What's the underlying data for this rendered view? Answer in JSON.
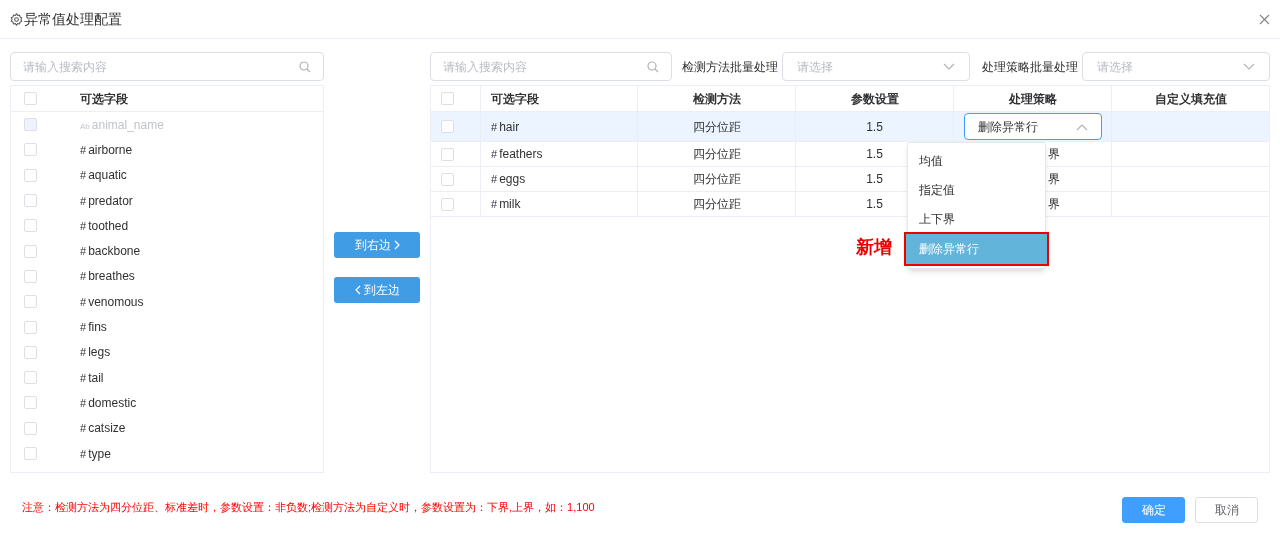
{
  "dialog": {
    "title": "异常值处理配置"
  },
  "left_panel": {
    "search": {
      "placeholder": "请输入搜索内容"
    },
    "header": {
      "label": "可选字段",
      "checked": false
    },
    "items": [
      {
        "type_mark": "Ab",
        "kind": "text",
        "label": "animal_name",
        "checked": false,
        "disabled": true
      },
      {
        "type_mark": "#",
        "kind": "number",
        "label": "airborne",
        "checked": false,
        "disabled": false
      },
      {
        "type_mark": "#",
        "kind": "number",
        "label": "aquatic",
        "checked": false,
        "disabled": false
      },
      {
        "type_mark": "#",
        "kind": "number",
        "label": "predator",
        "checked": false,
        "disabled": false
      },
      {
        "type_mark": "#",
        "kind": "number",
        "label": "toothed",
        "checked": false,
        "disabled": false
      },
      {
        "type_mark": "#",
        "kind": "number",
        "label": "backbone",
        "checked": false,
        "disabled": false
      },
      {
        "type_mark": "#",
        "kind": "number",
        "label": "breathes",
        "checked": false,
        "disabled": false
      },
      {
        "type_mark": "#",
        "kind": "number",
        "label": "venomous",
        "checked": false,
        "disabled": false
      },
      {
        "type_mark": "#",
        "kind": "number",
        "label": "fins",
        "checked": false,
        "disabled": false
      },
      {
        "type_mark": "#",
        "kind": "number",
        "label": "legs",
        "checked": false,
        "disabled": false
      },
      {
        "type_mark": "#",
        "kind": "number",
        "label": "tail",
        "checked": false,
        "disabled": false
      },
      {
        "type_mark": "#",
        "kind": "number",
        "label": "domestic",
        "checked": false,
        "disabled": false
      },
      {
        "type_mark": "#",
        "kind": "number",
        "label": "catsize",
        "checked": false,
        "disabled": false
      },
      {
        "type_mark": "#",
        "kind": "number",
        "label": "type",
        "checked": false,
        "disabled": false
      }
    ]
  },
  "transfer_buttons": [
    {
      "label": "到右边",
      "kind": "right"
    },
    {
      "label": "到左边",
      "kind": "left"
    }
  ],
  "right_panel": {
    "search": {
      "placeholder": "请输入搜索内容"
    },
    "batch_selects": [
      {
        "label": "检测方法批量处理",
        "placeholder": "请选择"
      },
      {
        "label": "处理策略批量处理",
        "placeholder": "请选择"
      }
    ],
    "table": {
      "header_checked": false,
      "columns": [
        "可选字段",
        "检测方法",
        "参数设置",
        "处理策略",
        "自定义填充值"
      ],
      "rows": [
        {
          "checked": false,
          "selected": true,
          "type_mark": "#",
          "field": "hair",
          "method": "四分位距",
          "param": "1.5",
          "kind": "select",
          "strategy": "删除异常行",
          "expanded": true
        },
        {
          "checked": false,
          "selected": false,
          "type_mark": "#",
          "field": "feathers",
          "method": "四分位距",
          "param": "1.5",
          "kind": "text",
          "strategy": "界"
        },
        {
          "checked": false,
          "selected": false,
          "type_mark": "#",
          "field": "eggs",
          "method": "四分位距",
          "param": "1.5",
          "kind": "text",
          "strategy": "界"
        },
        {
          "checked": false,
          "selected": false,
          "type_mark": "#",
          "field": "milk",
          "method": "四分位距",
          "param": "1.5",
          "kind": "text",
          "strategy": "界"
        }
      ]
    },
    "dropdown": {
      "annotation": "新增",
      "options": [
        {
          "label": "均值",
          "selected": false,
          "annotated": false
        },
        {
          "label": "指定值",
          "selected": false,
          "annotated": false
        },
        {
          "label": "上下界",
          "selected": false,
          "annotated": false
        },
        {
          "label": "删除异常行",
          "selected": true,
          "annotated": true
        }
      ]
    }
  },
  "footer": {
    "note": "注意：检测方法为四分位距、标准差时，参数设置：非负数;检测方法为自定义时，参数设置为：下界,上界，如：1,100",
    "buttons": [
      {
        "label": "确定",
        "kind": "primary"
      },
      {
        "label": "取消",
        "kind": "default"
      }
    ]
  }
}
